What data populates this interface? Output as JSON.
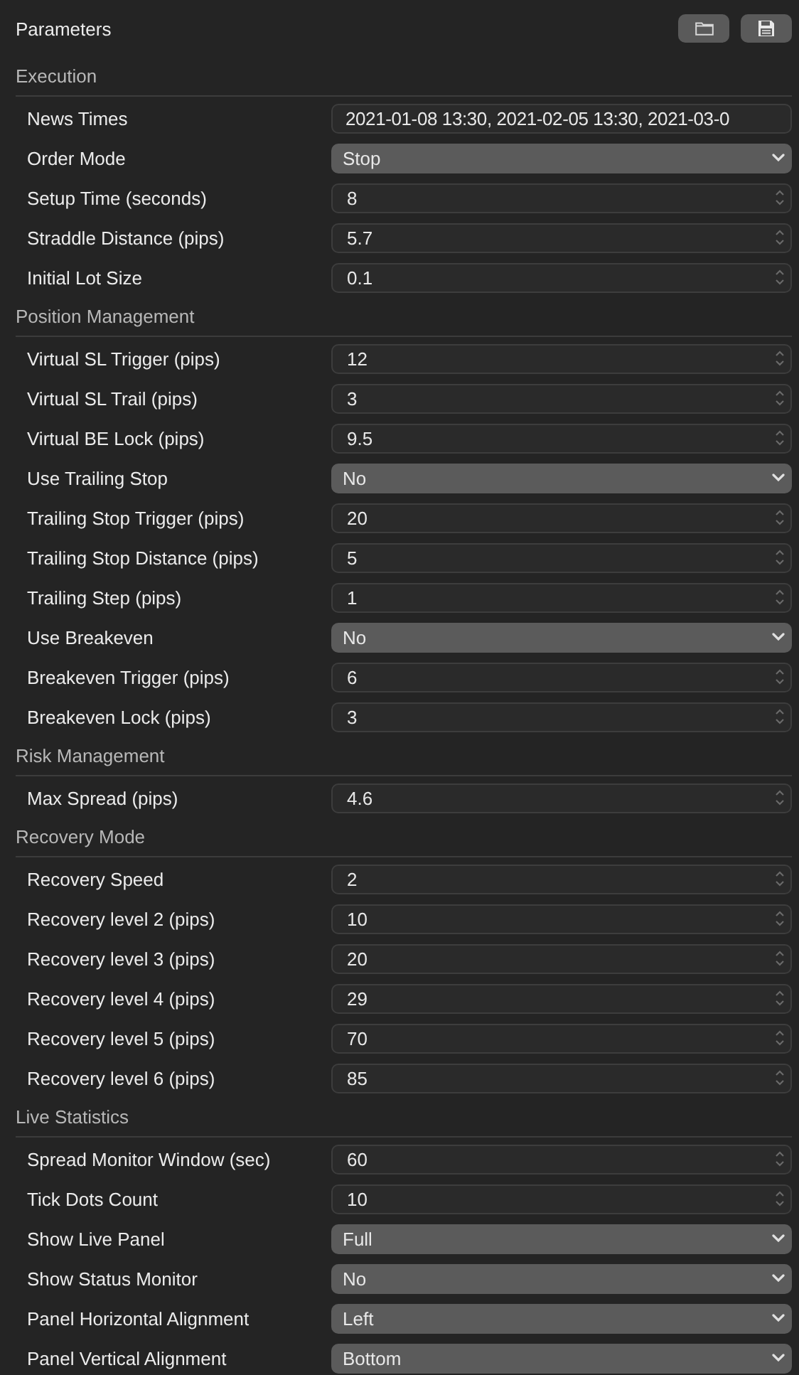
{
  "panel": {
    "title": "Parameters"
  },
  "sections": [
    {
      "title": "Execution",
      "rows": [
        {
          "label": "News Times",
          "kind": "text",
          "value": "2021-01-08 13:30, 2021-02-05 13:30, 2021-03-0"
        },
        {
          "label": "Order Mode",
          "kind": "select",
          "value": "Stop"
        },
        {
          "label": "Setup Time (seconds)",
          "kind": "number",
          "value": "8"
        },
        {
          "label": "Straddle Distance (pips)",
          "kind": "number",
          "value": "5.7"
        },
        {
          "label": "Initial Lot Size",
          "kind": "number",
          "value": "0.1"
        }
      ]
    },
    {
      "title": "Position Management",
      "rows": [
        {
          "label": "Virtual SL Trigger (pips)",
          "kind": "number",
          "value": "12"
        },
        {
          "label": "Virtual SL Trail (pips)",
          "kind": "number",
          "value": "3"
        },
        {
          "label": "Virtual BE Lock (pips)",
          "kind": "number",
          "value": "9.5"
        },
        {
          "label": "Use Trailing Stop",
          "kind": "select",
          "value": "No"
        },
        {
          "label": "Trailing Stop Trigger (pips)",
          "kind": "number",
          "value": "20"
        },
        {
          "label": "Trailing Stop Distance (pips)",
          "kind": "number",
          "value": "5"
        },
        {
          "label": "Trailing Step (pips)",
          "kind": "number",
          "value": "1"
        },
        {
          "label": "Use Breakeven",
          "kind": "select",
          "value": "No"
        },
        {
          "label": "Breakeven Trigger (pips)",
          "kind": "number",
          "value": "6"
        },
        {
          "label": "Breakeven Lock (pips)",
          "kind": "number",
          "value": "3"
        }
      ]
    },
    {
      "title": "Risk Management",
      "rows": [
        {
          "label": "Max Spread (pips)",
          "kind": "number",
          "value": "4.6"
        }
      ]
    },
    {
      "title": "Recovery Mode",
      "rows": [
        {
          "label": "Recovery Speed",
          "kind": "number",
          "value": "2"
        },
        {
          "label": "Recovery level 2 (pips)",
          "kind": "number",
          "value": "10"
        },
        {
          "label": "Recovery level 3 (pips)",
          "kind": "number",
          "value": "20"
        },
        {
          "label": "Recovery level 4 (pips)",
          "kind": "number",
          "value": "29"
        },
        {
          "label": "Recovery level 5 (pips)",
          "kind": "number",
          "value": "70"
        },
        {
          "label": "Recovery level 6 (pips)",
          "kind": "number",
          "value": "85"
        }
      ]
    },
    {
      "title": "Live Statistics",
      "rows": [
        {
          "label": "Spread Monitor Window (sec)",
          "kind": "number",
          "value": "60"
        },
        {
          "label": "Tick Dots Count",
          "kind": "number",
          "value": "10"
        },
        {
          "label": "Show Live Panel",
          "kind": "select",
          "value": "Full"
        },
        {
          "label": "Show Status Monitor",
          "kind": "select",
          "value": "No"
        },
        {
          "label": "Panel Horizontal Alignment",
          "kind": "select",
          "value": "Left"
        },
        {
          "label": "Panel Vertical Alignment",
          "kind": "select",
          "value": "Bottom"
        }
      ]
    }
  ]
}
